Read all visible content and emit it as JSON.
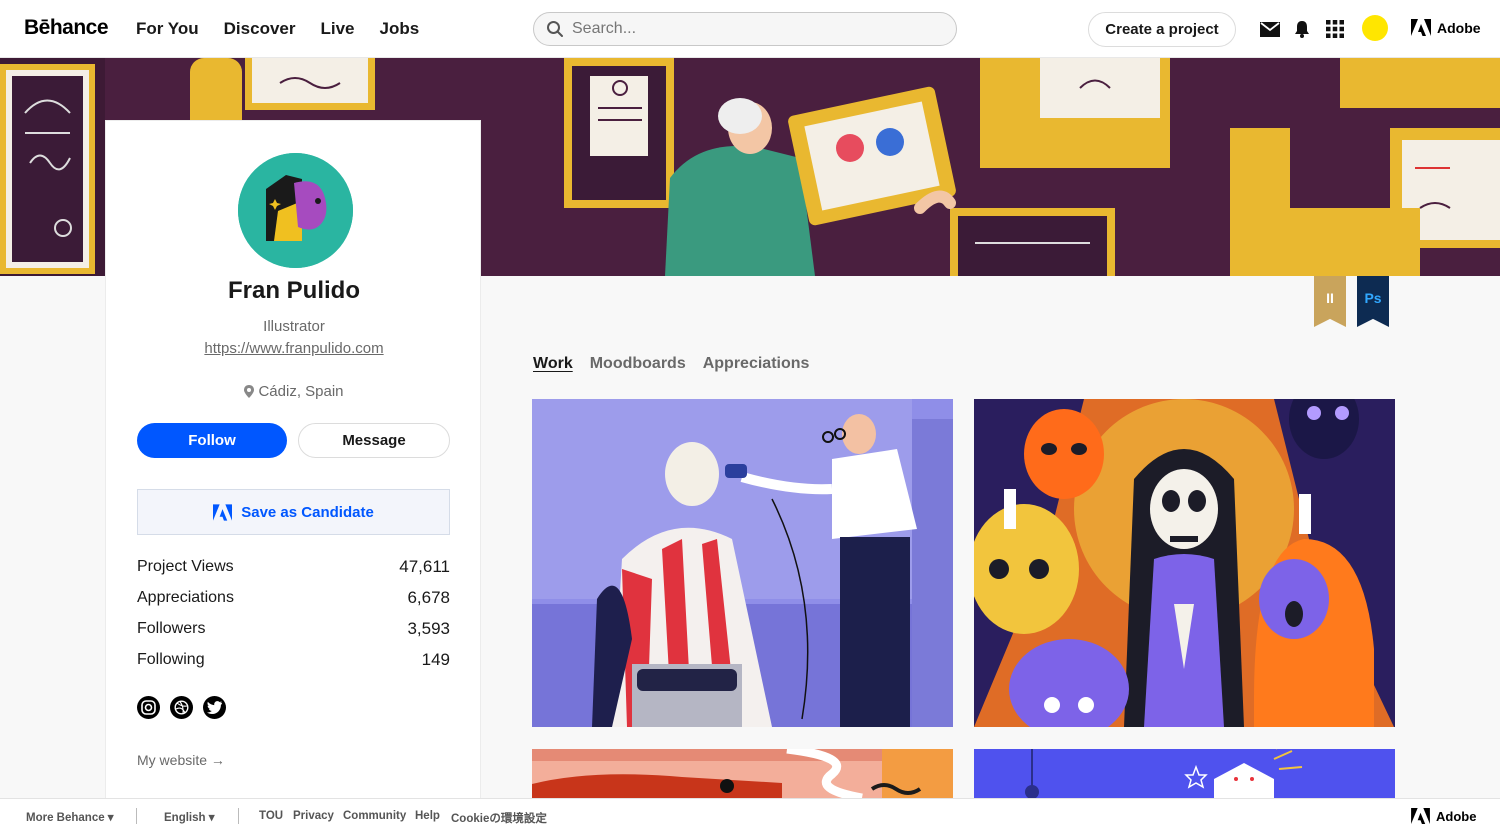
{
  "nav": {
    "logo": "Bēhance",
    "links": [
      "For You",
      "Discover",
      "Live",
      "Jobs"
    ],
    "search_placeholder": "Search...",
    "create_label": "Create a project",
    "adobe_label": "Adobe"
  },
  "profile": {
    "name": "Fran Pulido",
    "occupation": "Illustrator",
    "url": "https://www.franpulido.com",
    "location": "Cádiz, Spain",
    "follow_label": "Follow",
    "message_label": "Message",
    "candidate_label": "Save as Candidate",
    "stats": [
      {
        "label": "Project Views",
        "value": "47,611"
      },
      {
        "label": "Appreciations",
        "value": "6,678"
      },
      {
        "label": "Followers",
        "value": "3,593"
      },
      {
        "label": "Following",
        "value": "149"
      }
    ],
    "socials": [
      "instagram-icon",
      "dribbble-icon",
      "twitter-icon"
    ],
    "my_website_label": "My website →"
  },
  "ribbons": [
    {
      "label": "II",
      "bg": "#c9a45c",
      "fg": "#ffffff"
    },
    {
      "label": "Ps",
      "bg": "#0d2b52",
      "fg": "#31a8ff"
    }
  ],
  "tabs": {
    "work": "Work",
    "moodboards": "Moodboards",
    "appreciations": "Appreciations"
  },
  "footer": {
    "more_behance": "More Behance ▾",
    "language": "English ▾",
    "tou": "TOU",
    "privacy": "Privacy",
    "community": "Community",
    "help": "Help",
    "cookie": "Cookieの環境設定",
    "adobe_label": "Adobe"
  },
  "colors": {
    "primary_blue": "#0057ff",
    "avatar_teal": "#2ab5a1",
    "user_yellow": "#ffe600",
    "banner_purple": "#4a1f3f"
  }
}
